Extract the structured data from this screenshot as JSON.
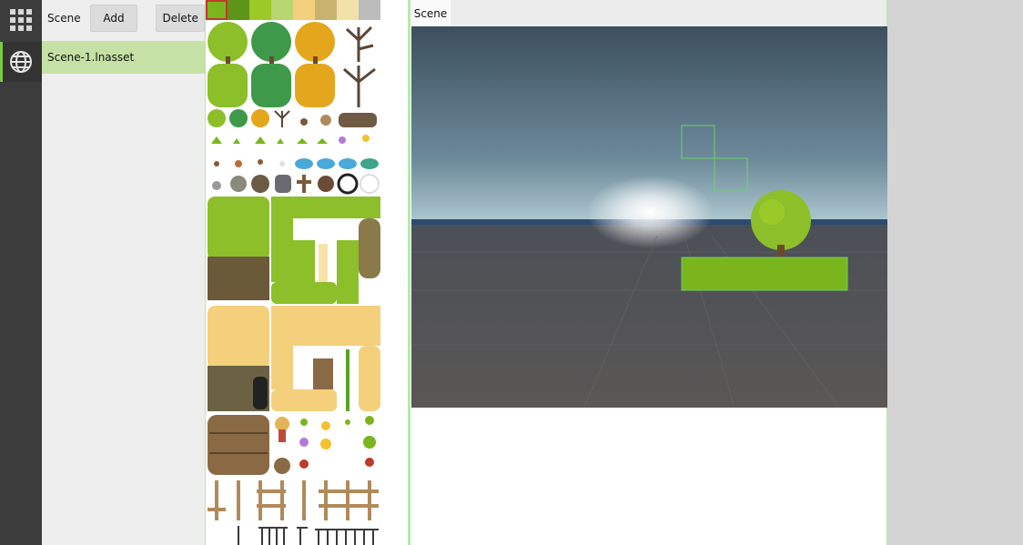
{
  "rail": {
    "icons": [
      "grid-icon",
      "globe-icon"
    ],
    "accent": "#7ac943"
  },
  "scene_panel": {
    "title": "Scene",
    "add_label": "Add",
    "delete_label": "Delete",
    "items": [
      {
        "label": "Scene-1.lnasset",
        "selected": true
      }
    ],
    "selected_color": "#c5e1a5"
  },
  "palette": {
    "top_swatches": [
      "#7ab51d",
      "#5e9418",
      "#9dc926",
      "#b8d672",
      "#f4d07c",
      "#c8b26f",
      "#f2e2a8",
      "#bcbcbc"
    ],
    "selected_swatch_border": "#c0392b"
  },
  "scene_view": {
    "tab_label": "Scene",
    "sky_top": "#3c4f5e",
    "horizon": "#e4f0f3",
    "ground": "#5a5755"
  }
}
